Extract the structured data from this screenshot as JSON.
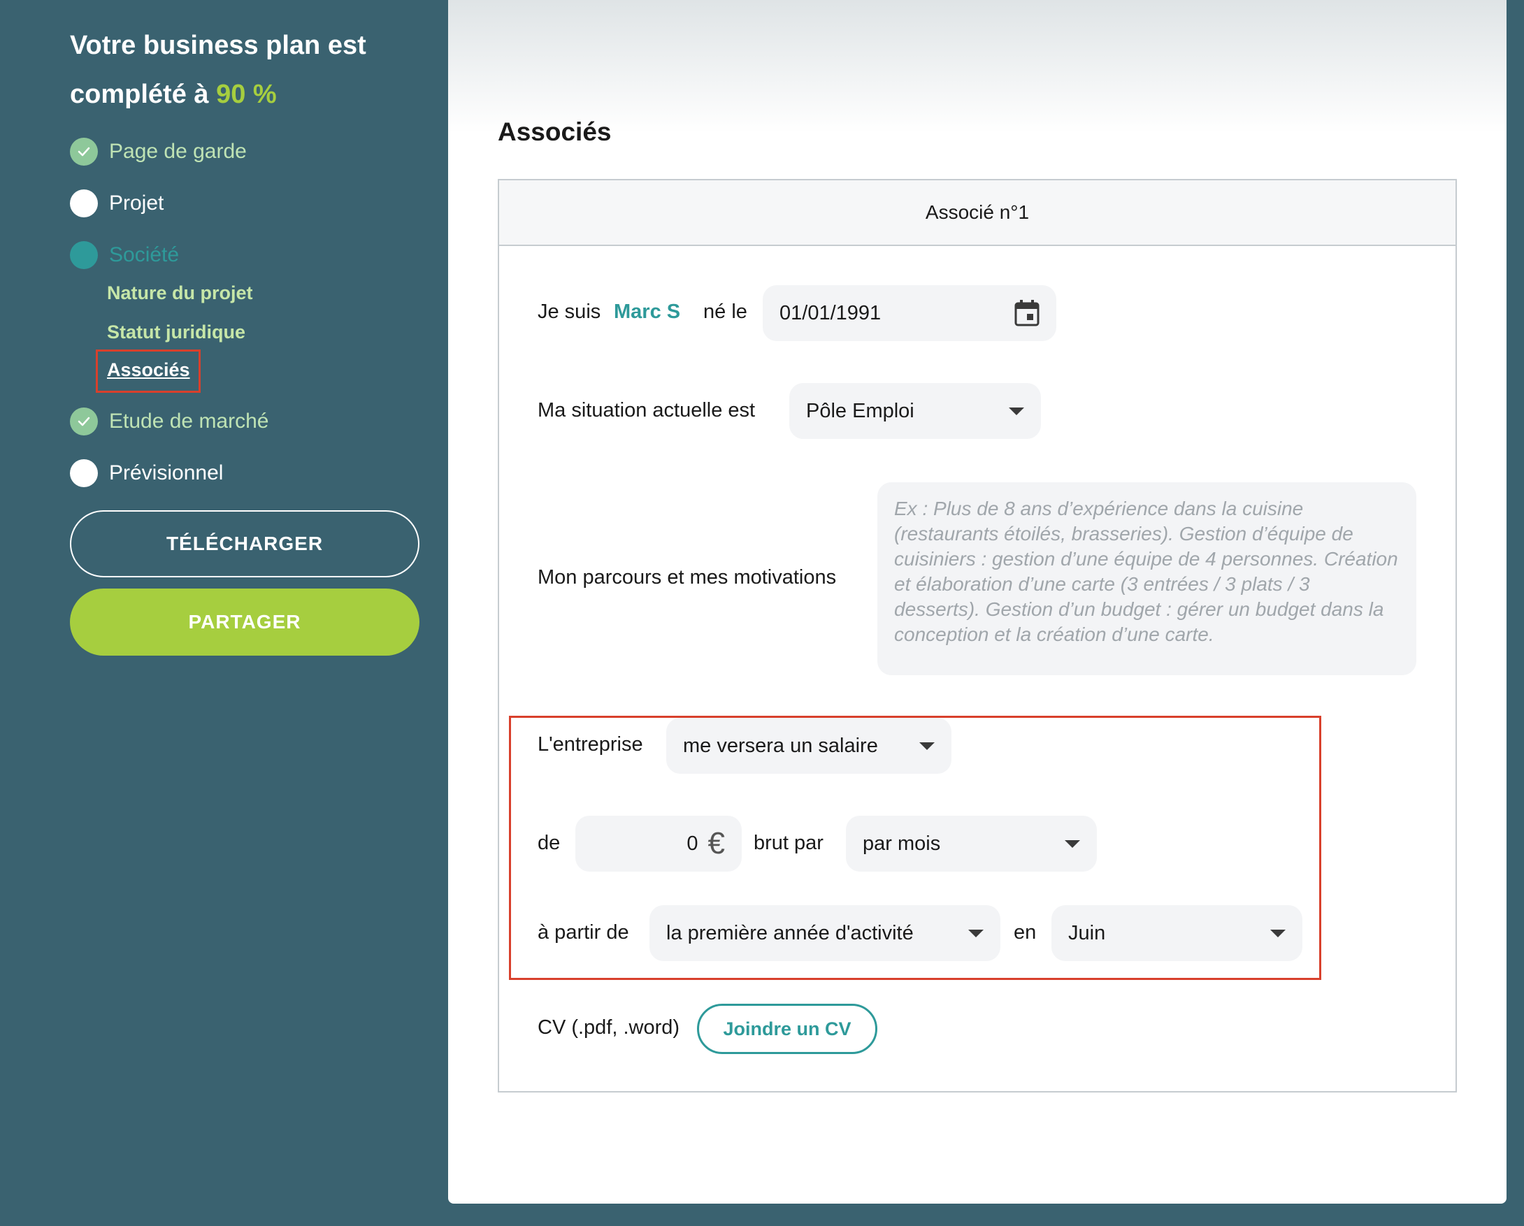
{
  "sidebar": {
    "progress_prefix": "Votre business plan est complété à ",
    "progress_value": "90 %",
    "steps": [
      {
        "label": "Page de garde",
        "state": "done"
      },
      {
        "label": "Projet",
        "state": "todo"
      },
      {
        "label": "Société",
        "state": "current"
      },
      {
        "label": "Etude de marché",
        "state": "done"
      },
      {
        "label": "Prévisionnel",
        "state": "todo"
      }
    ],
    "substeps": [
      {
        "label": "Nature du projet"
      },
      {
        "label": "Statut juridique"
      },
      {
        "label": "Associés",
        "active": true
      }
    ],
    "download_label": "TÉLÉCHARGER",
    "share_label": "PARTAGER"
  },
  "main": {
    "title": "Associés",
    "card": {
      "header": "Associé n°1",
      "je_suis_label": "Je suis",
      "name": "Marc S",
      "ne_le_label": "né le",
      "birth_date": "01/01/1991",
      "situation_label": "Ma situation actuelle est",
      "situation_value": "Pôle Emploi",
      "parcours_label": "Mon parcours et mes motivations",
      "parcours_placeholder": "Ex : Plus de 8 ans d’expérience dans la cuisine (restaurants étoilés, brasseries). Gestion d’équipe de cuisiniers : gestion d’une équipe de 4 personnes. Création et élaboration d’une carte (3 entrées / 3 plats / 3 desserts). Gestion d’un budget : gérer un budget dans la conception et la création d’une carte.",
      "entreprise_label": "L'entreprise",
      "entreprise_value": "me versera un salaire",
      "de_label": "de",
      "salary_value": "0",
      "currency_symbol": "€",
      "brut_par_label": "brut par",
      "period_value": "par mois",
      "a_partir_label": "à partir de",
      "start_year_value": "la première année d'activité",
      "en_label": "en",
      "month_value": "Juin",
      "cv_label": "CV (.pdf, .word)",
      "cv_button": "Joindre un CV"
    }
  },
  "colors": {
    "sidebar_bg": "#3a6270",
    "accent_green": "#a6ce3f",
    "teal": "#2e9a9a",
    "highlight_red": "#d8402c"
  }
}
